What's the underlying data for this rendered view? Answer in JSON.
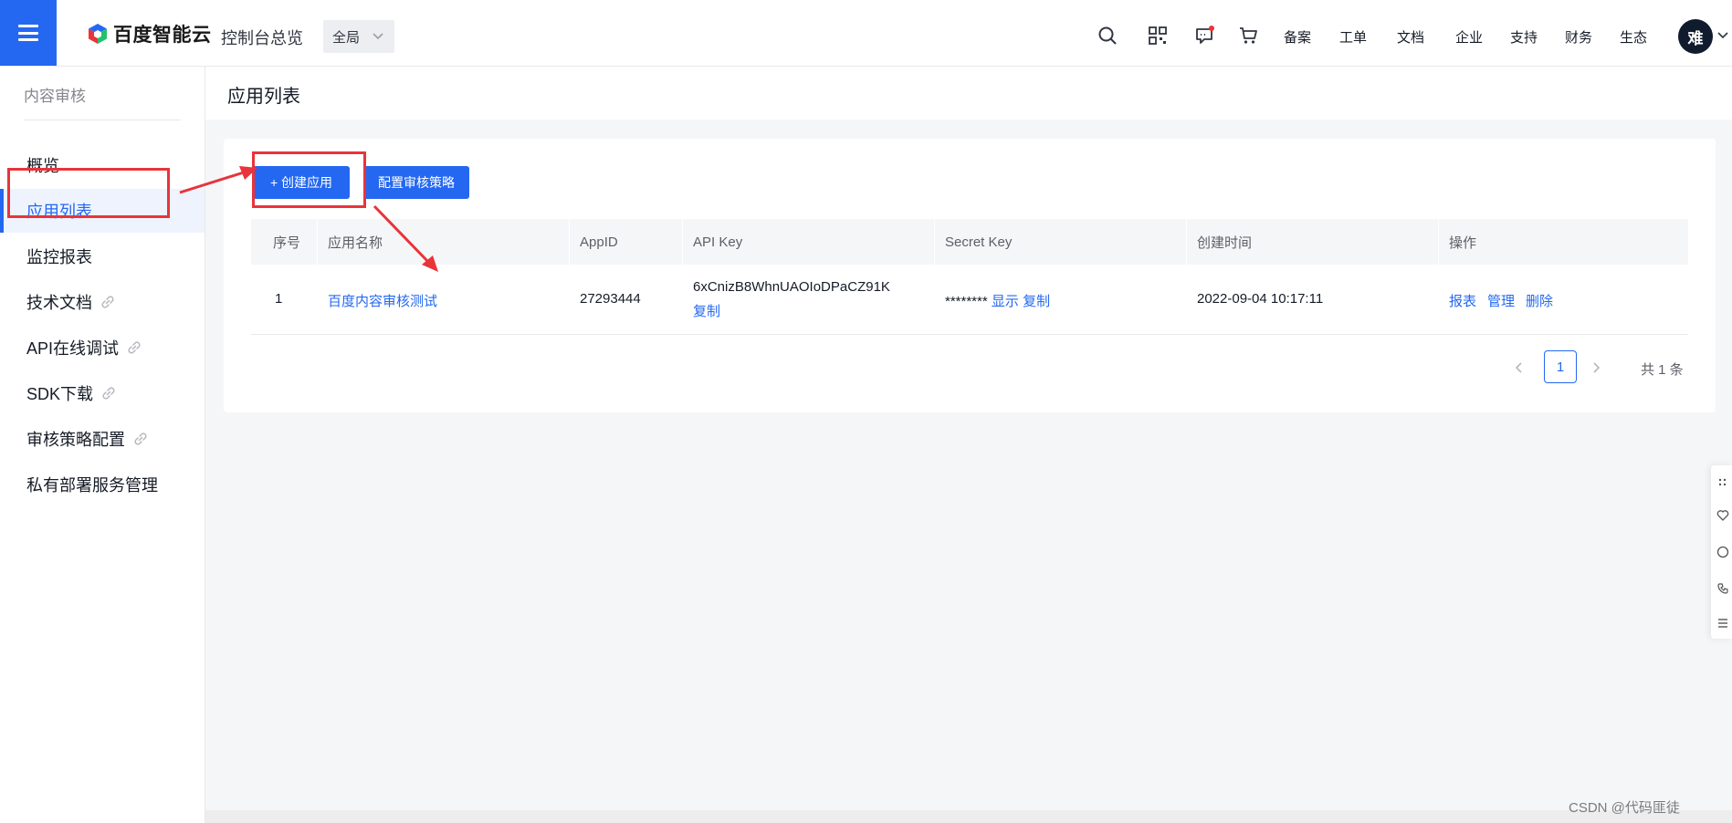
{
  "topbar": {
    "brand": "百度智能云",
    "console_label": "控制台总览",
    "scope_value": "全局",
    "icons": [
      "search-icon",
      "grid-icon",
      "message-icon",
      "cart-icon"
    ],
    "nav_links": [
      "备案",
      "工单",
      "文档",
      "企业",
      "支持",
      "财务",
      "生态"
    ],
    "avatar_text": "难"
  },
  "sidebar": {
    "title": "内容审核",
    "items": [
      {
        "label": "概览"
      },
      {
        "label": "应用列表"
      },
      {
        "label": "监控报表"
      },
      {
        "label": "技术文档"
      },
      {
        "label": "API在线调试"
      },
      {
        "label": "SDK下载"
      },
      {
        "label": "审核策略配置"
      },
      {
        "label": "私有部署服务管理"
      }
    ]
  },
  "page": {
    "title": "应用列表",
    "buttons": {
      "create_app": "+ 创建应用",
      "config_policy": "配置审核策略"
    },
    "table": {
      "headers": [
        "序号",
        "应用名称",
        "AppID",
        "API Key",
        "Secret Key",
        "创建时间",
        "操作"
      ],
      "rows": [
        {
          "index": "1",
          "app_name": "百度内容审核测试",
          "app_id": "27293444",
          "api_key": "6xCnizB8WhnUAOIoDPaCZ91K",
          "api_key_copy": "复制",
          "secret_masked": "********",
          "secret_show": "显示",
          "secret_copy": "复制",
          "created_at": "2022-09-04 10:17:11",
          "actions": [
            "报表",
            "管理",
            "删除"
          ]
        }
      ]
    },
    "pagination": {
      "current_page": "1",
      "total_text": "共 1 条"
    }
  },
  "watermark": "CSDN @代码匪徒",
  "colors": {
    "primary": "#2468f2",
    "annotation": "#e8343a"
  }
}
